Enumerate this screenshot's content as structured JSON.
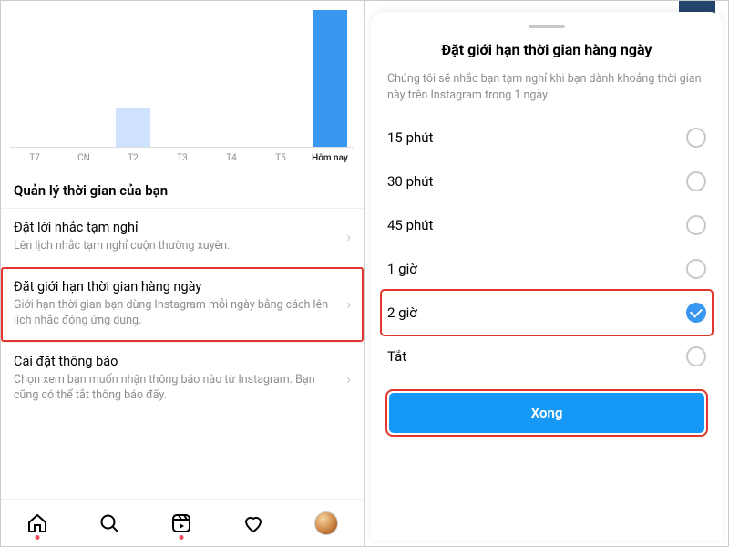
{
  "left": {
    "section_title": "Quản lý thời gian của bạn",
    "rows": [
      {
        "title": "Đặt lời nhắc tạm nghỉ",
        "sub": "Lên lịch nhắc tạm nghỉ cuộn thường xuyên.",
        "highlight": false
      },
      {
        "title": "Đặt giới hạn thời gian hàng ngày",
        "sub": "Giới hạn thời gian bạn dùng Instagram mỗi ngày bằng cách lên lịch nhắc đóng ứng dụng.",
        "highlight": true
      },
      {
        "title": "Cài đặt thông báo",
        "sub": "Chọn xem bạn muốn nhận thông báo nào từ Instagram. Bạn cũng có thể tắt thông báo đấy.",
        "highlight": false
      }
    ]
  },
  "right": {
    "title": "Đặt giới hạn thời gian hàng ngày",
    "desc": "Chúng tôi sẽ nhắc bạn tạm nghỉ khi bạn dành khoảng thời gian này trên Instagram trong 1 ngày.",
    "options": [
      {
        "label": "15 phút",
        "checked": false,
        "highlight": false
      },
      {
        "label": "30 phút",
        "checked": false,
        "highlight": false
      },
      {
        "label": "45 phút",
        "checked": false,
        "highlight": false
      },
      {
        "label": "1 giờ",
        "checked": false,
        "highlight": false
      },
      {
        "label": "2 giờ",
        "checked": true,
        "highlight": true
      },
      {
        "label": "Tắt",
        "checked": false,
        "highlight": false
      }
    ],
    "done": "Xong"
  },
  "chart_data": {
    "type": "bar",
    "categories": [
      "T7",
      "CN",
      "T2",
      "T3",
      "T4",
      "T5",
      "Hôm nay"
    ],
    "values": [
      0,
      0,
      28,
      0,
      0,
      0,
      100
    ],
    "title": "",
    "xlabel": "",
    "ylabel": "",
    "ylim": [
      0,
      100
    ],
    "active_index": 6,
    "colors": {
      "bar": "#cfe2ff",
      "active_bar": "#3897f0"
    }
  }
}
